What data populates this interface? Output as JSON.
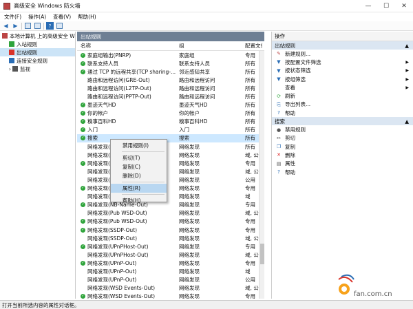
{
  "window": {
    "title": "高级安全 Windows 防火墙",
    "minimize": "—",
    "maximize": "☐",
    "close": "✕"
  },
  "menubar": [
    "文件(F)",
    "操作(A)",
    "查看(V)",
    "帮助(H)"
  ],
  "tree": [
    {
      "label": "本地计算机 上的高级安全 Windows",
      "icon": "firewall-icon",
      "indent": 0
    },
    {
      "label": "入站规则",
      "icon": "inbound-rules-icon",
      "indent": 1
    },
    {
      "label": "出站规则",
      "icon": "outbound-rules-icon",
      "indent": 1,
      "selected": true
    },
    {
      "label": "连接安全规则",
      "icon": "connection-rules-icon",
      "indent": 1
    },
    {
      "label": "监视",
      "icon": "monitor-icon",
      "indent": 1,
      "expand": "›"
    }
  ],
  "main": {
    "title": "出站规则",
    "columns": [
      "名称",
      "组",
      "配置文件"
    ],
    "rows": [
      {
        "name": "家庭组输出(PNRP)",
        "group": "家庭组",
        "profile": "专用",
        "enabled": true
      },
      {
        "name": "联系支持人员",
        "group": "联系支持人员",
        "profile": "所有",
        "enabled": true
      },
      {
        "name": "通过 TCP 的远程共享(TCP sharing-...",
        "group": "邻近感知共享",
        "profile": "所有",
        "enabled": true
      },
      {
        "name": "路由和远程访问(GRE-Out)",
        "group": "路由和远程访问",
        "profile": "所有",
        "enabled": false
      },
      {
        "name": "路由和远程访问(L2TP-Out)",
        "group": "路由和远程访问",
        "profile": "所有",
        "enabled": false
      },
      {
        "name": "路由和远程访问(PPTP-Out)",
        "group": "路由和远程访问",
        "profile": "所有",
        "enabled": false
      },
      {
        "name": "墨迹天气HD",
        "group": "墨迹天气HD",
        "profile": "所有",
        "enabled": true
      },
      {
        "name": "你的帐户",
        "group": "你的帐户",
        "profile": "所有",
        "enabled": true
      },
      {
        "name": "糗事百科HD",
        "group": "糗事百科HD",
        "profile": "所有",
        "enabled": true
      },
      {
        "name": "入门",
        "group": "入门",
        "profile": "所有",
        "enabled": true
      },
      {
        "name": "搜索",
        "group": "搜索",
        "profile": "所有",
        "enabled": true,
        "selected": true
      },
      {
        "name": "网络发现(",
        "group": "网络发现",
        "profile": "所有",
        "enabled": false
      },
      {
        "name": "网络发现(",
        "group": "网络发现",
        "profile": "域, 公用",
        "enabled": false
      },
      {
        "name": "网络发现(",
        "group": "网络发现",
        "profile": "专用",
        "enabled": true
      },
      {
        "name": "网络发现(",
        "group": "网络发现",
        "profile": "域, 公用",
        "enabled": false
      },
      {
        "name": "网络发现(",
        "group": "网络发现",
        "profile": "公用",
        "enabled": false
      },
      {
        "name": "网络发现(",
        "group": "网络发现",
        "profile": "专用",
        "enabled": true
      },
      {
        "name": "网络发现(",
        "group": "网络发现",
        "profile": "域",
        "enabled": false
      },
      {
        "name": "网络发现(NB-Name-Out)",
        "group": "网络发现",
        "profile": "专用",
        "enabled": true
      },
      {
        "name": "网络发现(Pub WSD-Out)",
        "group": "网络发现",
        "profile": "域, 公用",
        "enabled": false
      },
      {
        "name": "网络发现(Pub WSD-Out)",
        "group": "网络发现",
        "profile": "专用",
        "enabled": true
      },
      {
        "name": "网络发现(SSDP-Out)",
        "group": "网络发现",
        "profile": "专用",
        "enabled": true
      },
      {
        "name": "网络发现(SSDP-Out)",
        "group": "网络发现",
        "profile": "域, 公用",
        "enabled": false
      },
      {
        "name": "网络发现(UPnPHost-Out)",
        "group": "网络发现",
        "profile": "专用",
        "enabled": true
      },
      {
        "name": "网络发现(UPnPHost-Out)",
        "group": "网络发现",
        "profile": "域, 公用",
        "enabled": false
      },
      {
        "name": "网络发现(UPnP-Out)",
        "group": "网络发现",
        "profile": "专用",
        "enabled": true
      },
      {
        "name": "网络发现(UPnP-Out)",
        "group": "网络发现",
        "profile": "域",
        "enabled": false
      },
      {
        "name": "网络发现(UPnP-Out)",
        "group": "网络发现",
        "profile": "公用",
        "enabled": false
      },
      {
        "name": "网络发现(WSD Events-Out)",
        "group": "网络发现",
        "profile": "域, 公用",
        "enabled": false
      },
      {
        "name": "网络发现(WSD Events-Out)",
        "group": "网络发现",
        "profile": "专用",
        "enabled": true
      }
    ]
  },
  "context_menu": [
    {
      "label": "禁用规则(I)"
    },
    {
      "sep": true
    },
    {
      "label": "剪切(T)"
    },
    {
      "label": "复制(C)"
    },
    {
      "label": "删除(D)"
    },
    {
      "sep": true
    },
    {
      "label": "属性(R)",
      "highlight": true
    },
    {
      "sep": true
    },
    {
      "label": "帮助(H)"
    }
  ],
  "actions": {
    "title": "操作",
    "group1": {
      "title": "出站规则",
      "items": [
        {
          "label": "新建规则...",
          "icon": "new-rule-icon",
          "glyph": "✎",
          "color": "#b44"
        },
        {
          "label": "按配置文件筛选",
          "icon": "filter-icon",
          "glyph": "▼",
          "color": "#2a6db5",
          "arrow": true
        },
        {
          "label": "按状态筛选",
          "icon": "filter-icon",
          "glyph": "▼",
          "color": "#2a6db5",
          "arrow": true
        },
        {
          "label": "按组筛选",
          "icon": "filter-icon",
          "glyph": "▼",
          "color": "#2a6db5",
          "arrow": true
        },
        {
          "label": "查看",
          "icon": "view-icon",
          "glyph": "",
          "color": "#fff",
          "arrow": true
        },
        {
          "label": "刷新",
          "icon": "refresh-icon",
          "glyph": "⟳",
          "color": "#2fa43b"
        },
        {
          "label": "导出列表...",
          "icon": "export-icon",
          "glyph": "⎘",
          "color": "#2a6db5"
        },
        {
          "label": "帮助",
          "icon": "help-icon",
          "glyph": "?",
          "color": "#2a6db5"
        }
      ]
    },
    "group2": {
      "title": "搜索",
      "items": [
        {
          "label": "禁用规则",
          "icon": "disable-icon",
          "glyph": "●",
          "color": "#555"
        },
        {
          "label": "剪切",
          "icon": "cut-icon",
          "glyph": "✂",
          "color": "#333"
        },
        {
          "label": "复制",
          "icon": "copy-icon",
          "glyph": "❐",
          "color": "#2a6db5"
        },
        {
          "label": "删除",
          "icon": "delete-icon",
          "glyph": "✕",
          "color": "#d22"
        },
        {
          "label": "属性",
          "icon": "properties-icon",
          "glyph": "▤",
          "color": "#555"
        },
        {
          "label": "帮助",
          "icon": "help-icon",
          "glyph": "?",
          "color": "#2a6db5"
        }
      ]
    }
  },
  "statusbar": "打开当前所选内容的属性对话框。",
  "watermark": "fan.com.cn"
}
